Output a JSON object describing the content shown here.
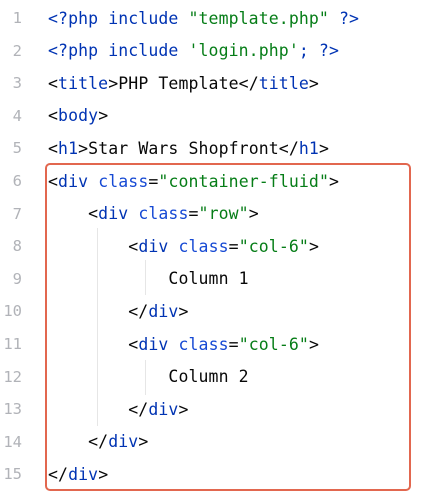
{
  "editor": {
    "lines": [
      {
        "number": "1",
        "tokens": [
          {
            "text": "<?php include ",
            "kind": "php"
          },
          {
            "text": "\"template.php\"",
            "kind": "str"
          },
          {
            "text": " ?>",
            "kind": "php"
          }
        ]
      },
      {
        "number": "2",
        "tokens": [
          {
            "text": "<?php include ",
            "kind": "php"
          },
          {
            "text": "'login.php'",
            "kind": "str"
          },
          {
            "text": "; ?>",
            "kind": "php"
          }
        ]
      },
      {
        "number": "3",
        "tokens": [
          {
            "text": "<",
            "kind": "plain"
          },
          {
            "text": "title",
            "kind": "tag"
          },
          {
            "text": ">PHP Template</",
            "kind": "plain"
          },
          {
            "text": "title",
            "kind": "tag"
          },
          {
            "text": ">",
            "kind": "plain"
          }
        ]
      },
      {
        "number": "4",
        "tokens": [
          {
            "text": "<",
            "kind": "plain"
          },
          {
            "text": "body",
            "kind": "tag"
          },
          {
            "text": ">",
            "kind": "plain"
          }
        ]
      },
      {
        "number": "5",
        "tokens": [
          {
            "text": "<",
            "kind": "plain"
          },
          {
            "text": "h1",
            "kind": "tag"
          },
          {
            "text": ">Star Wars Shopfront</",
            "kind": "plain"
          },
          {
            "text": "h1",
            "kind": "tag"
          },
          {
            "text": ">",
            "kind": "plain"
          }
        ]
      },
      {
        "number": "6",
        "tokens": [
          {
            "text": "<",
            "kind": "plain"
          },
          {
            "text": "div",
            "kind": "tag"
          },
          {
            "text": " ",
            "kind": "plain"
          },
          {
            "text": "class",
            "kind": "attr"
          },
          {
            "text": "=",
            "kind": "plain"
          },
          {
            "text": "\"container-fluid\"",
            "kind": "str"
          },
          {
            "text": ">",
            "kind": "plain"
          }
        ]
      },
      {
        "number": "7",
        "tokens": [
          {
            "text": "    <",
            "kind": "plain"
          },
          {
            "text": "div",
            "kind": "tag"
          },
          {
            "text": " ",
            "kind": "plain"
          },
          {
            "text": "class",
            "kind": "attr"
          },
          {
            "text": "=",
            "kind": "plain"
          },
          {
            "text": "\"row\"",
            "kind": "str"
          },
          {
            "text": ">",
            "kind": "plain"
          }
        ]
      },
      {
        "number": "8",
        "tokens": [
          {
            "text": "        <",
            "kind": "plain"
          },
          {
            "text": "div",
            "kind": "tag"
          },
          {
            "text": " ",
            "kind": "plain"
          },
          {
            "text": "class",
            "kind": "attr"
          },
          {
            "text": "=",
            "kind": "plain"
          },
          {
            "text": "\"col-6\"",
            "kind": "str"
          },
          {
            "text": ">",
            "kind": "plain"
          }
        ]
      },
      {
        "number": "9",
        "tokens": [
          {
            "text": "            Column 1",
            "kind": "plain"
          }
        ]
      },
      {
        "number": "10",
        "tokens": [
          {
            "text": "        </",
            "kind": "plain"
          },
          {
            "text": "div",
            "kind": "tag"
          },
          {
            "text": ">",
            "kind": "plain"
          }
        ]
      },
      {
        "number": "11",
        "tokens": [
          {
            "text": "        <",
            "kind": "plain"
          },
          {
            "text": "div",
            "kind": "tag"
          },
          {
            "text": " ",
            "kind": "plain"
          },
          {
            "text": "class",
            "kind": "attr"
          },
          {
            "text": "=",
            "kind": "plain"
          },
          {
            "text": "\"col-6\"",
            "kind": "str"
          },
          {
            "text": ">",
            "kind": "plain"
          }
        ]
      },
      {
        "number": "12",
        "tokens": [
          {
            "text": "            Column 2",
            "kind": "plain"
          }
        ]
      },
      {
        "number": "13",
        "tokens": [
          {
            "text": "        </",
            "kind": "plain"
          },
          {
            "text": "div",
            "kind": "tag"
          },
          {
            "text": ">",
            "kind": "plain"
          }
        ]
      },
      {
        "number": "14",
        "tokens": [
          {
            "text": "    </",
            "kind": "plain"
          },
          {
            "text": "div",
            "kind": "tag"
          },
          {
            "text": ">",
            "kind": "plain"
          }
        ]
      },
      {
        "number": "15",
        "tokens": [
          {
            "text": "</",
            "kind": "plain"
          },
          {
            "text": "div",
            "kind": "tag"
          },
          {
            "text": ">",
            "kind": "plain"
          }
        ]
      }
    ],
    "colors": {
      "tag": "#0033b3",
      "attribute": "#174ad4",
      "string": "#067d17",
      "text": "#080808",
      "line_number": "#b1b3b8",
      "highlight_border": "#e2674f"
    }
  }
}
